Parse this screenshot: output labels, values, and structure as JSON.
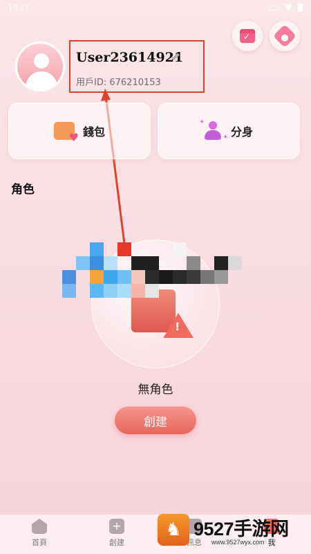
{
  "status_bar": {
    "time": "10:17"
  },
  "profile": {
    "username": "User23614921",
    "user_id": "用戶ID: 676210153"
  },
  "cards": {
    "wallet_label": "錢包",
    "clone_label": "分身"
  },
  "section": {
    "title": "角色"
  },
  "empty_state": {
    "text": "無角色",
    "button_label": "創建"
  },
  "tabbar": {
    "items": [
      {
        "label": "首頁",
        "icon": "home-icon"
      },
      {
        "label": "創建",
        "icon": "plus-icon"
      },
      {
        "label": "訊息",
        "icon": "message-icon"
      },
      {
        "label": "我",
        "icon": "me-icon"
      }
    ]
  },
  "watermark": {
    "brand": "9527手游网",
    "url": "www.9527wyx.com"
  },
  "annotation": {
    "box_color": "#e0402e",
    "arrow_color": "#e0402e"
  },
  "icons": [
    "calendar-check-icon",
    "settings-icon",
    "edit-pencil-icon",
    "wallet-icon",
    "clone-icon",
    "warning-icon"
  ]
}
